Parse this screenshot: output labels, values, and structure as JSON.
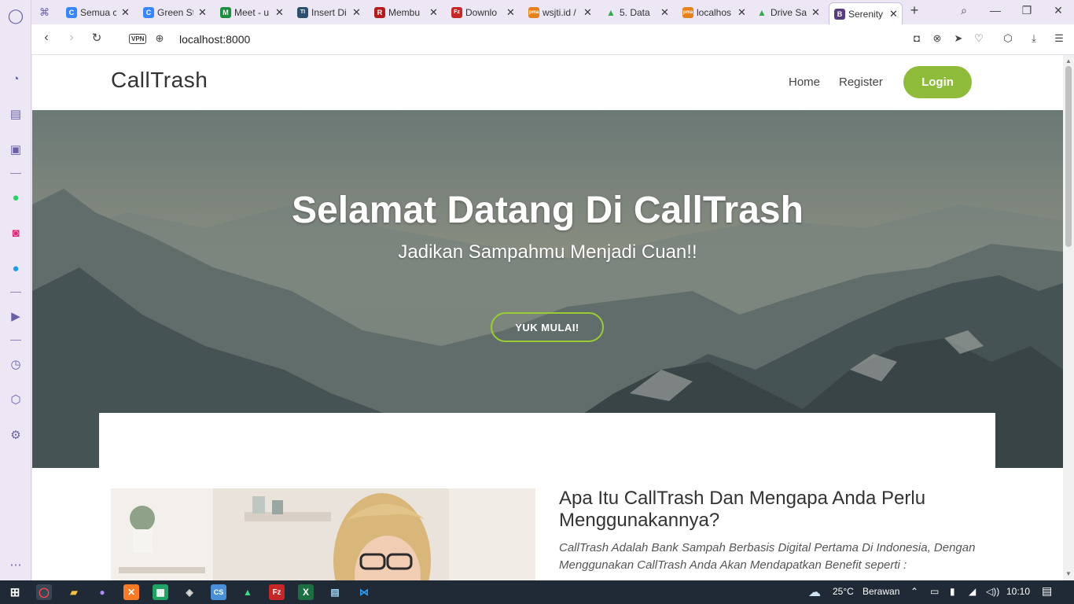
{
  "browser": {
    "tabs": [
      {
        "title": "Semua c",
        "icon": "C",
        "color": "#3a86ff"
      },
      {
        "title": "Green St",
        "icon": "C",
        "color": "#3a86ff"
      },
      {
        "title": "Meet - u",
        "icon": "M",
        "color": "#1e8e3e"
      },
      {
        "title": "Insert Di",
        "icon": "TI",
        "color": "#2b4f6e"
      },
      {
        "title": "Membu",
        "icon": "R",
        "color": "#b71c1c"
      },
      {
        "title": "Downlo",
        "icon": "Fz",
        "color": "#c62828"
      },
      {
        "title": "wsjti.id /",
        "icon": "pma",
        "color": "#e6821e"
      },
      {
        "title": "5. Data",
        "icon": "▲",
        "color": "#34a853"
      },
      {
        "title": "localhos",
        "icon": "pma",
        "color": "#e6821e"
      },
      {
        "title": "Drive Sa",
        "icon": "▲",
        "color": "#34a853"
      },
      {
        "title": "Serenity",
        "icon": "B",
        "color": "#563d7c",
        "active": true
      }
    ],
    "new_tab": "+",
    "url": "localhost:8000",
    "vpn": "VPN"
  },
  "site": {
    "brand": "CallTrash",
    "nav": {
      "home": "Home",
      "register": "Register",
      "login": "Login"
    },
    "hero": {
      "title": "Selamat Datang Di CallTrash",
      "subtitle": "Jadikan Sampahmu Menjadi Cuan!!",
      "cta": "YUK MULAI!"
    },
    "about": {
      "title": "Apa Itu CallTrash Dan Mengapa Anda Perlu Menggunakannya?",
      "description": "CallTrash Adalah Bank Sampah Berbasis Digital Pertama Di Indonesia, Dengan Menggunakan CallTrash Anda Akan Mendapatkan Benefit seperti :"
    }
  },
  "taskbar": {
    "weather": "25°C",
    "weather_desc": "Berawan",
    "time": "10:10"
  },
  "colors": {
    "accent": "#8fbb3a",
    "cta_border": "#9acd32",
    "browser_chrome": "#ece6f5"
  }
}
